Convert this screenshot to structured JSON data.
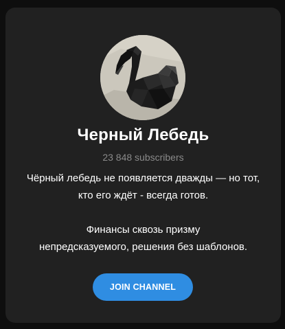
{
  "channel": {
    "avatar_icon": "black-swan-icon",
    "name": "Черный Лебедь",
    "subscribers": "23 848 subscribers",
    "description_line1": "Чёрный лебедь не появляется дважды — но тот,",
    "description_line2": "кто его ждёт - всегда готов.",
    "description_line3": "Финансы сквозь призму",
    "description_line4": "непредсказуемого, решения без шаблонов."
  },
  "actions": {
    "join_label": "JOIN CHANNEL"
  },
  "colors": {
    "card_bg": "#212121",
    "page_bg": "#0e0e0e",
    "accent": "#2f8de2",
    "muted_text": "#8a8a8a"
  }
}
